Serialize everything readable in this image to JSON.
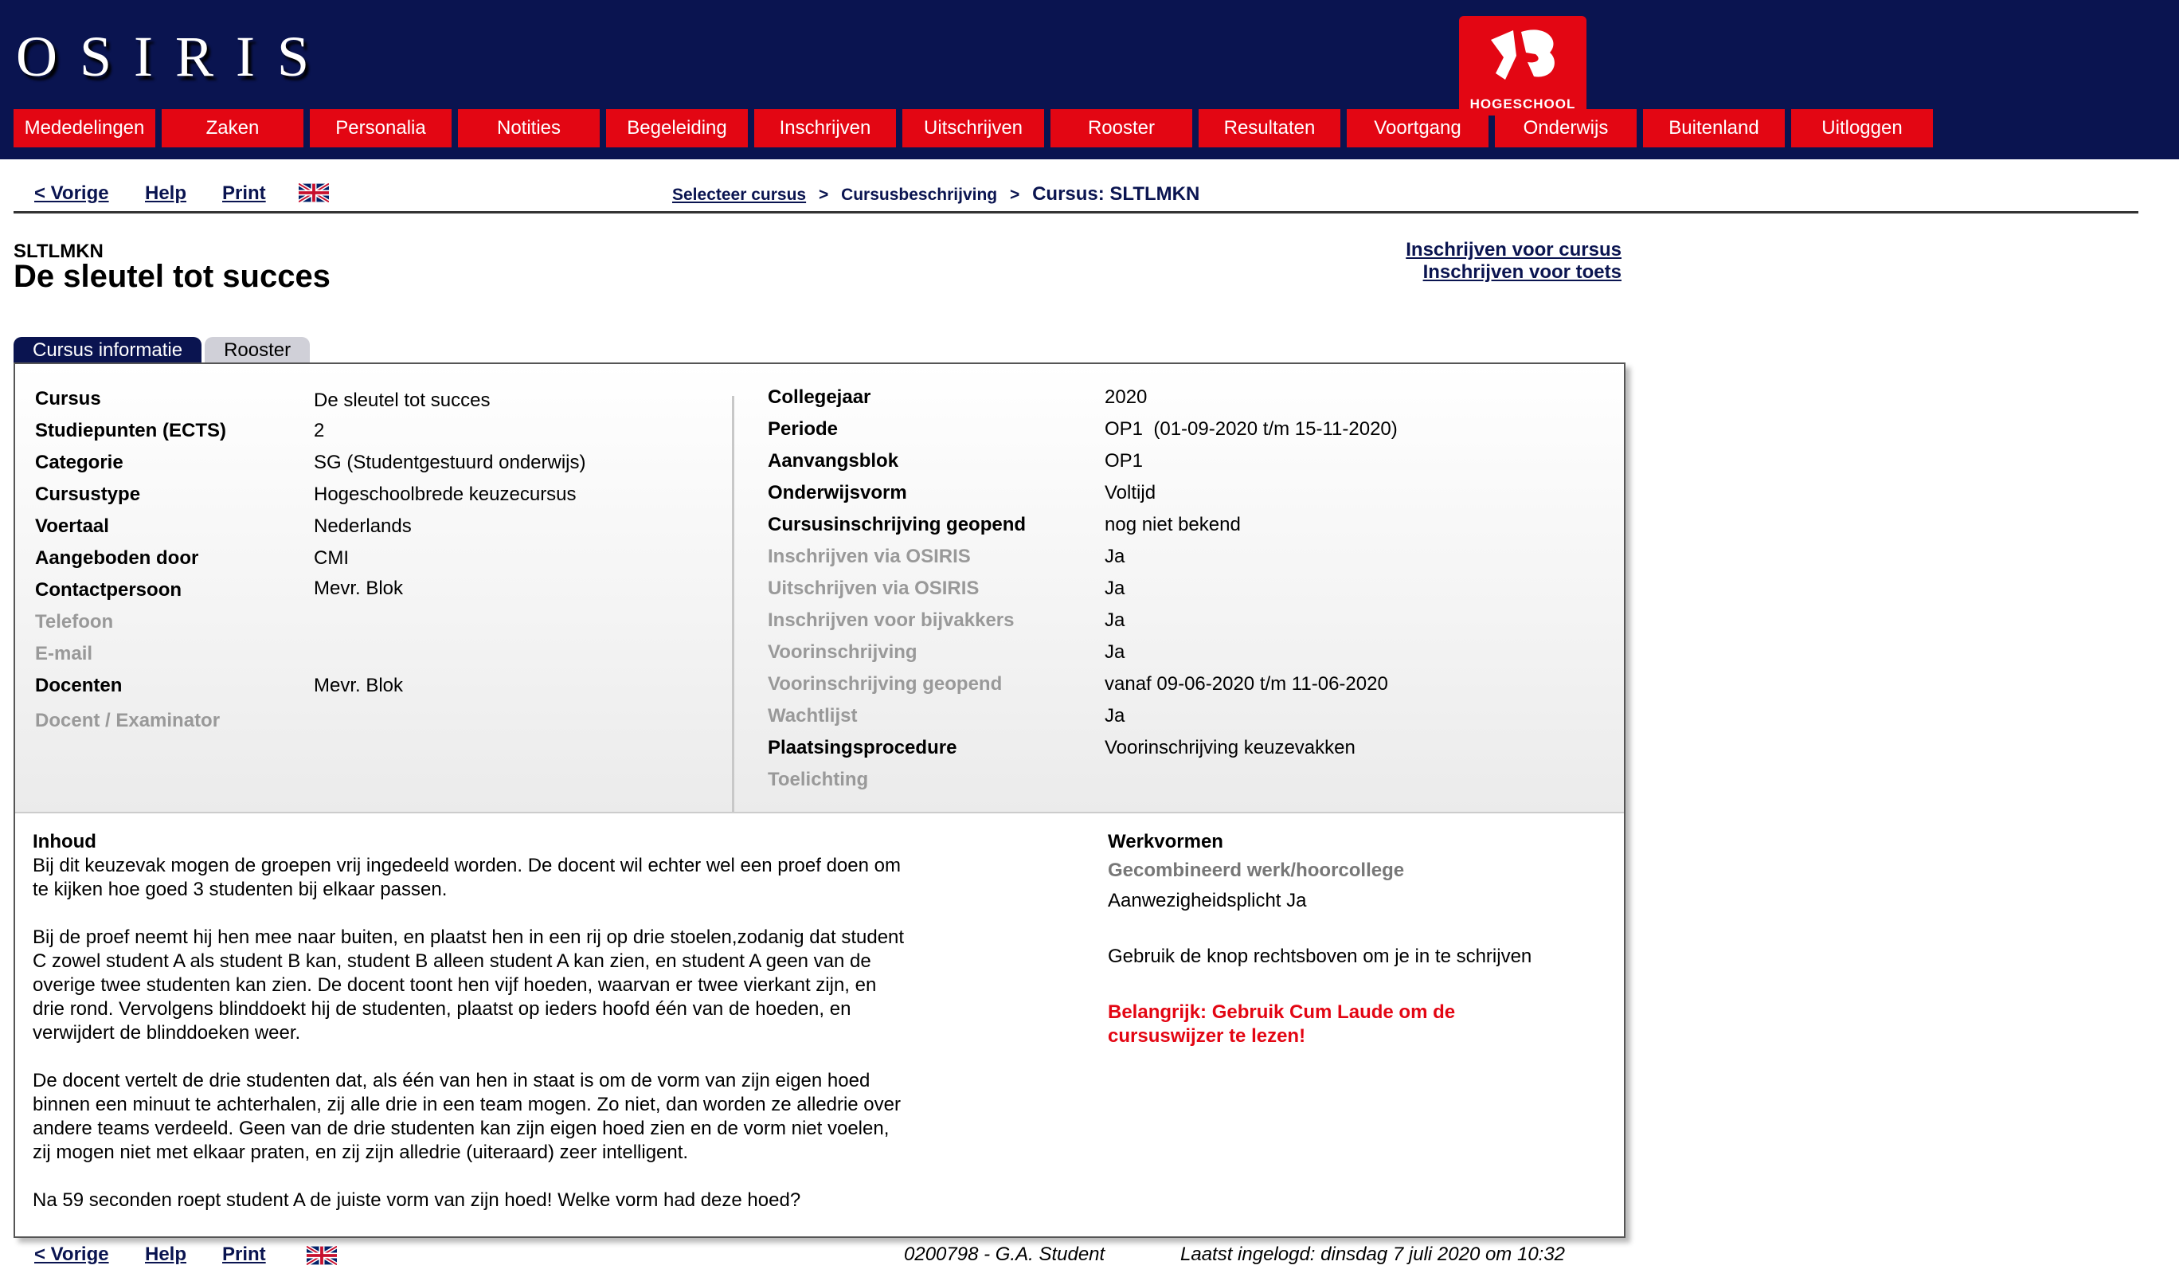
{
  "app": {
    "name": "OSIRIS",
    "logo_label": "HOGESCHOOL"
  },
  "nav": [
    "Mededelingen",
    "Zaken",
    "Personalia",
    "Notities",
    "Begeleiding",
    "Inschrijven",
    "Uitschrijven",
    "Rooster",
    "Resultaten",
    "Voortgang",
    "Onderwijs",
    "Buitenland",
    "Uitloggen"
  ],
  "toolbar": {
    "prev": "< Vorige",
    "help": "Help",
    "print": "Print"
  },
  "breadcrumb": {
    "link": "Selecteer cursus",
    "sep": ">",
    "middle": "Cursusbeschrijving",
    "current": "Cursus: SLTLMKN"
  },
  "course": {
    "code": "SLTLMKN",
    "title": "De sleutel tot succes"
  },
  "actions": {
    "enroll_course": "Inschrijven voor cursus",
    "enroll_test": "Inschrijven voor toets"
  },
  "tabs": [
    "Cursus informatie",
    "Rooster"
  ],
  "left_info": [
    {
      "label": "Cursus",
      "value": "De sleutel tot succes",
      "dim": false
    },
    {
      "label": "Studiepunten (ECTS)",
      "value": "2",
      "dim": false
    },
    {
      "label": "Categorie",
      "value": "SG (Studentgestuurd onderwijs)",
      "dim": false
    },
    {
      "label": "Cursustype",
      "value": "Hogeschoolbrede keuzecursus",
      "dim": false
    },
    {
      "label": "Voertaal",
      "value": "Nederlands",
      "dim": false
    },
    {
      "label": "Aangeboden door",
      "value": "CMI",
      "dim": false
    },
    {
      "label": "Contactpersoon",
      "value": "Mevr. Blok",
      "dim": false
    },
    {
      "label": "Telefoon",
      "value": "",
      "dim": true
    },
    {
      "label": "E-mail",
      "value": "",
      "dim": true
    },
    {
      "label": "Docenten",
      "value": "Mevr. Blok",
      "dim": false
    },
    {
      "label": "Docent / Examinator",
      "value": "",
      "dim": true
    }
  ],
  "right_info": [
    {
      "label": "Collegejaar",
      "value": "2020",
      "dim": false
    },
    {
      "label": "Periode",
      "value": "OP1  (01-09-2020 t/m 15-11-2020)",
      "dim": false
    },
    {
      "label": "Aanvangsblok",
      "value": "OP1",
      "dim": false
    },
    {
      "label": "Onderwijsvorm",
      "value": "Voltijd",
      "dim": false
    },
    {
      "label": "Cursusinschrijving geopend",
      "value": "nog niet bekend",
      "dim": false
    },
    {
      "label": "Inschrijven via OSIRIS",
      "value": "Ja",
      "dim": true
    },
    {
      "label": "Uitschrijven via OSIRIS",
      "value": "Ja",
      "dim": true
    },
    {
      "label": "Inschrijven voor bijvakkers",
      "value": "Ja",
      "dim": true
    },
    {
      "label": "Voorinschrijving",
      "value": "Ja",
      "dim": true
    },
    {
      "label": "Voorinschrijving geopend",
      "value": "vanaf 09-06-2020 t/m 11-06-2020",
      "dim": true
    },
    {
      "label": "Wachtlijst",
      "value": "Ja",
      "dim": true
    },
    {
      "label": "Plaatsingsprocedure",
      "value": "Voorinschrijving keuzevakken",
      "dim": false
    },
    {
      "label": "Toelichting",
      "value": "",
      "dim": true
    }
  ],
  "inhoud": {
    "heading": "Inhoud",
    "paragraphs": [
      "Bij dit keuzevak mogen de groepen vrij ingedeeld worden. De docent wil echter wel een proef doen om te kijken hoe goed 3 studenten bij elkaar passen.",
      "Bij de proef neemt hij hen mee naar buiten, en plaatst hen in een rij op drie stoelen,zodanig dat student C zowel student A als student B kan, student B alleen student A kan zien, en student A geen van de overige twee studenten kan zien. De docent toont hen vijf hoeden, waarvan er twee vierkant zijn, en drie rond. Vervolgens blinddoekt hij de studenten, plaatst op ieders hoofd één van de hoeden, en verwijdert de blinddoeken weer.",
      "De docent vertelt de drie studenten dat, als één van hen in staat is om de vorm van zijn eigen hoed binnen een minuut te achterhalen, zij alle drie in een team mogen. Zo niet, dan worden ze alledrie over andere teams verdeeld. Geen van de drie studenten kan zijn eigen hoed zien en de vorm niet voelen, zij mogen niet met elkaar praten, en zij zijn alledrie (uiteraard) zeer intelligent.",
      "Na 59 seconden roept student A de juiste vorm van zijn hoed! Welke vorm had deze hoed?"
    ]
  },
  "werkvormen": {
    "heading": "Werkvormen",
    "type": "Gecombineerd werk/hoorcollege",
    "attendance": "Aanwezigheidsplicht Ja",
    "instruction": "Gebruik de knop rechtsboven om je in te schrijven",
    "warning": "Belangrijk: Gebruik Cum Laude om de cursuswijzer te lezen!"
  },
  "footer": {
    "student": "0200798 - G.A. Student",
    "last_login": "Laatst ingelogd: dinsdag 7 juli 2020 om 10:32"
  },
  "colors": {
    "navy": "#0a1450",
    "red": "#e30613"
  }
}
